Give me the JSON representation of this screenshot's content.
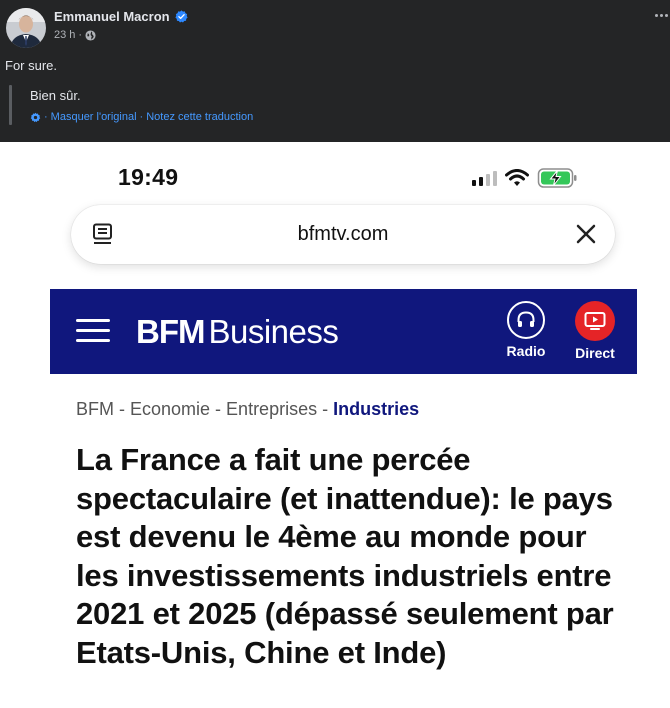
{
  "post": {
    "author": "Emmanuel Macron",
    "time": "23 h",
    "separator": "·",
    "text": "For sure.",
    "original_text": "Bien sûr.",
    "translation_links": {
      "sep1": "·",
      "hide_original": "Masquer l'original",
      "sep2": "·",
      "rate": "Notez cette traduction"
    }
  },
  "phone": {
    "status_time": "19:49",
    "url": "bfmtv.com",
    "site": {
      "brand_bold": "BFM",
      "brand_light": "Business",
      "radio_label": "Radio",
      "direct_label": "Direct",
      "accent_color": "#10177d",
      "live_color": "#e52427"
    },
    "breadcrumb": [
      "BFM",
      "Economie",
      "Entreprises",
      "Industries"
    ],
    "breadcrumb_sep": "-",
    "headline": "La France a fait une percée spectaculaire (et inattendue): le pays est devenu le 4ème au monde pour les investissements industriels entre 2021 et 2025 (dépassé seulement par Etats-Unis, Chine et Inde)"
  },
  "icons": {
    "verified": "verified-badge-icon",
    "audience": "globe-icon",
    "more": "more-options-icon",
    "translate": "translate-settings-icon",
    "reader": "reader-mode-icon",
    "close": "close-icon",
    "menu": "hamburger-menu-icon",
    "radio": "headphones-icon",
    "direct": "tv-play-icon",
    "signal": "cellular-signal-icon",
    "wifi": "wifi-icon",
    "battery": "battery-charging-icon"
  }
}
